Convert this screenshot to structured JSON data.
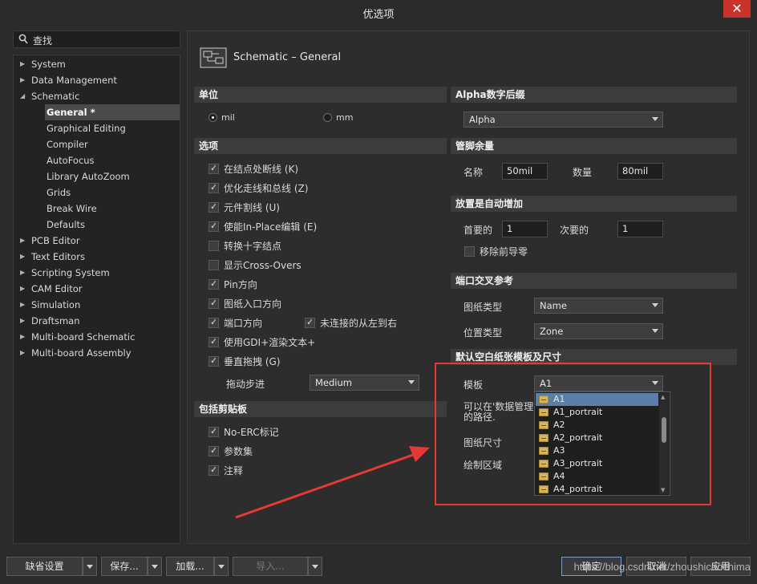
{
  "window": {
    "title": "优选项",
    "close_glyph": "✕"
  },
  "search": {
    "placeholder": "查找",
    "icon": "search-icon"
  },
  "tree": [
    {
      "label": "System",
      "expanded": false
    },
    {
      "label": "Data Management",
      "expanded": false
    },
    {
      "label": "Schematic",
      "expanded": true
    },
    {
      "label": "General *",
      "child": true,
      "selected": true
    },
    {
      "label": "Graphical Editing",
      "child": true
    },
    {
      "label": "Compiler",
      "child": true
    },
    {
      "label": "AutoFocus",
      "child": true
    },
    {
      "label": "Library AutoZoom",
      "child": true
    },
    {
      "label": "Grids",
      "child": true
    },
    {
      "label": "Break Wire",
      "child": true
    },
    {
      "label": "Defaults",
      "child": true
    },
    {
      "label": "PCB Editor",
      "expanded": false
    },
    {
      "label": "Text Editors",
      "expanded": false
    },
    {
      "label": "Scripting System",
      "expanded": false
    },
    {
      "label": "CAM Editor",
      "expanded": false
    },
    {
      "label": "Simulation",
      "expanded": false
    },
    {
      "label": "Draftsman",
      "expanded": false
    },
    {
      "label": "Multi-board Schematic",
      "expanded": false
    },
    {
      "label": "Multi-board Assembly",
      "expanded": false
    }
  ],
  "page": {
    "title": "Schematic – General"
  },
  "units": {
    "header": "单位",
    "mil": "mil",
    "mm": "mm",
    "selected": "mil"
  },
  "options": {
    "header": "选项",
    "items": [
      {
        "label": "在结点处断线 (K)",
        "checked": true
      },
      {
        "label": "优化走线和总线 (Z)",
        "checked": true
      },
      {
        "label": "元件割线 (U)",
        "checked": true
      },
      {
        "label": "使能In-Place编辑 (E)",
        "checked": true
      },
      {
        "label": "转换十字结点",
        "checked": false
      },
      {
        "label": "显示Cross-Overs",
        "checked": false
      },
      {
        "label": "Pin方向",
        "checked": true
      },
      {
        "label": "图纸入口方向",
        "checked": true
      },
      {
        "label": "端口方向",
        "checked": true
      },
      {
        "label": "使用GDI+渲染文本+",
        "checked": true
      },
      {
        "label": "垂直拖拽 (G)",
        "checked": true
      }
    ],
    "unconnected_label": "未连接的从左到右",
    "unconnected_checked": true,
    "drag_step_label": "拖动步进",
    "drag_step_value": "Medium"
  },
  "clipboard": {
    "header": "包括剪贴板",
    "items": [
      {
        "label": "No-ERC标记",
        "checked": true
      },
      {
        "label": "参数集",
        "checked": true
      },
      {
        "label": "注释",
        "checked": true
      }
    ]
  },
  "alpha": {
    "header": "Alpha数字后缀",
    "value": "Alpha"
  },
  "pin_margin": {
    "header": "管脚余量",
    "name_label": "名称",
    "name_value": "50mil",
    "number_label": "数量",
    "number_value": "80mil"
  },
  "auto_inc": {
    "header": "放置是自动增加",
    "primary_label": "首要的",
    "primary_value": "1",
    "secondary_label": "次要的",
    "secondary_value": "1",
    "remove_zero_label": "移除前导零",
    "remove_zero_checked": false
  },
  "port_xref": {
    "header": "端口交叉参考",
    "sheet_type_label": "图纸类型",
    "sheet_type_value": "Name",
    "loc_type_label": "位置类型",
    "loc_type_value": "Zone"
  },
  "template": {
    "header": "默认空白纸张模板及尺寸",
    "template_label": "模板",
    "template_value": "A1",
    "note_line1": "可以在'数据管理",
    "note_line2": "的路径.",
    "sheet_size_label": "图纸尺寸",
    "draw_area_label": "绘制区域",
    "options": [
      "A1",
      "A1_portrait",
      "A2",
      "A2_portrait",
      "A3",
      "A3_portrait",
      "A4",
      "A4_portrait"
    ],
    "selected": "A1"
  },
  "buttons": {
    "defaults": "缺省设置",
    "save": "保存...",
    "load": "加载...",
    "import": "导入...",
    "ok": "确定",
    "cancel": "取消",
    "apply": "应用"
  },
  "watermark": "https://blog.csdn.net/zhoushicaochima",
  "colors": {
    "highlight": "#e53935",
    "selection": "#5b7fa6",
    "close": "#c8332b"
  }
}
